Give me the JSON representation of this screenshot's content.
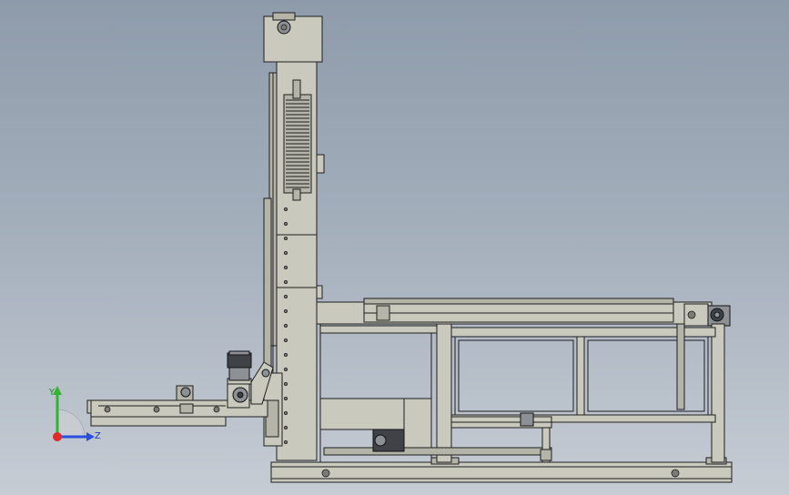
{
  "viewport": {
    "background_top": "#8e9baa",
    "background_bottom": "#c6ccd4"
  },
  "triad": {
    "y_label": "Y",
    "z_label": "Z",
    "y_color": "#2fb52f",
    "z_color": "#2a4ee0",
    "x_color": "#e02a2a"
  }
}
